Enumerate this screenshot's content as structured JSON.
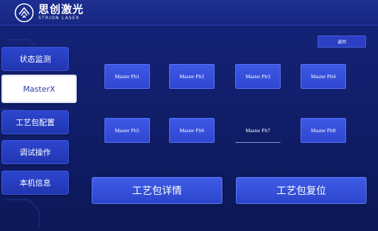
{
  "header": {
    "brand_cn": "思创激光",
    "brand_en": "STRION LASER"
  },
  "top_button": {
    "label": "返回"
  },
  "sidebar": {
    "items": [
      {
        "label": "状态监测"
      },
      {
        "label": "MasterX"
      },
      {
        "label": "工艺包配置"
      },
      {
        "label": "调试操作"
      },
      {
        "label": "本机信息"
      }
    ]
  },
  "plots": [
    {
      "label": "Master Plt1"
    },
    {
      "label": "Master Plt2"
    },
    {
      "label": "Master Plt3"
    },
    {
      "label": "Master Plt4"
    },
    {
      "label": "Master Plt5"
    },
    {
      "label": "Master Plt6"
    },
    {
      "label": "Master Plt7"
    },
    {
      "label": "Master Plt8"
    }
  ],
  "actions": {
    "details_label": "工艺包详情",
    "reset_label": "工艺包复位"
  },
  "colors": {
    "background": "#121f6c",
    "accent": "#3450dc",
    "active_tab_bg": "#ffffff"
  }
}
